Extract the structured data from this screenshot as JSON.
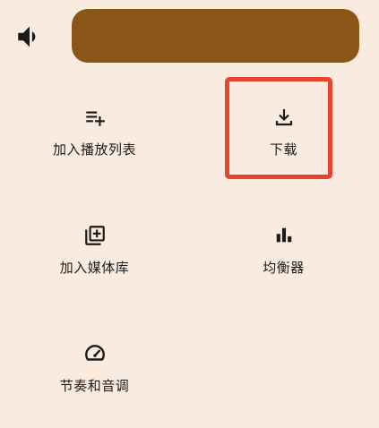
{
  "volume": {
    "icon": "volume-up-icon",
    "slider_color": "#8A5617"
  },
  "menu": {
    "items": [
      {
        "id": "add-to-playlist",
        "label": "加入播放列表",
        "icon": "playlist-add-icon"
      },
      {
        "id": "download",
        "label": "下载",
        "icon": "download-icon"
      },
      {
        "id": "add-to-library",
        "label": "加入媒体库",
        "icon": "library-add-icon"
      },
      {
        "id": "equalizer",
        "label": "均衡器",
        "icon": "equalizer-icon"
      },
      {
        "id": "speed-pitch",
        "label": "节奏和音调",
        "icon": "speed-icon"
      }
    ]
  },
  "theme": {
    "background": "#FAEBE0",
    "highlight": "#E8432E",
    "text": "#1C1B1A"
  }
}
